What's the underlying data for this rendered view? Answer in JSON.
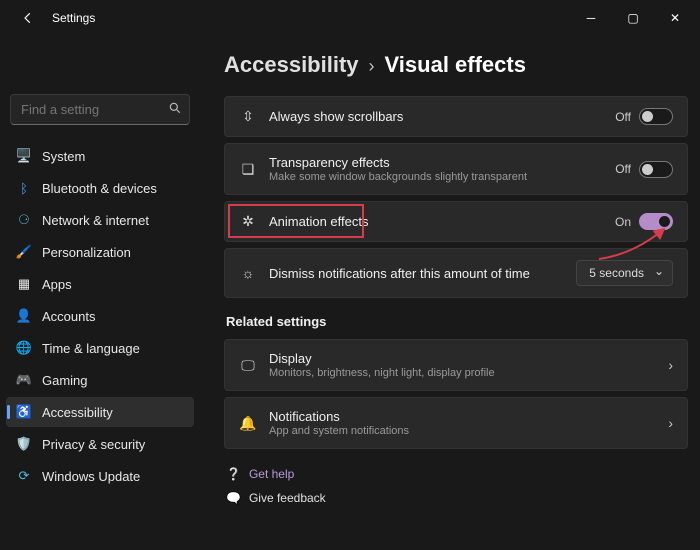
{
  "titlebar": {
    "title": "Settings"
  },
  "search": {
    "placeholder": "Find a setting"
  },
  "nav": [
    {
      "label": "System"
    },
    {
      "label": "Bluetooth & devices"
    },
    {
      "label": "Network & internet"
    },
    {
      "label": "Personalization"
    },
    {
      "label": "Apps"
    },
    {
      "label": "Accounts"
    },
    {
      "label": "Time & language"
    },
    {
      "label": "Gaming"
    },
    {
      "label": "Accessibility"
    },
    {
      "label": "Privacy & security"
    },
    {
      "label": "Windows Update"
    }
  ],
  "breadcrumb": {
    "main": "Accessibility",
    "sub": "Visual effects"
  },
  "rows": {
    "scrollbars": {
      "title": "Always show scrollbars",
      "state": "Off"
    },
    "transparency": {
      "title": "Transparency effects",
      "sub": "Make some window backgrounds slightly transparent",
      "state": "Off"
    },
    "animation": {
      "title": "Animation effects",
      "state": "On"
    },
    "dismiss": {
      "title": "Dismiss notifications after this amount of time",
      "value": "5 seconds"
    }
  },
  "related": {
    "heading": "Related settings",
    "display": {
      "title": "Display",
      "sub": "Monitors, brightness, night light, display profile"
    },
    "notifications": {
      "title": "Notifications",
      "sub": "App and system notifications"
    }
  },
  "footer": {
    "help": "Get help",
    "feedback": "Give feedback"
  }
}
